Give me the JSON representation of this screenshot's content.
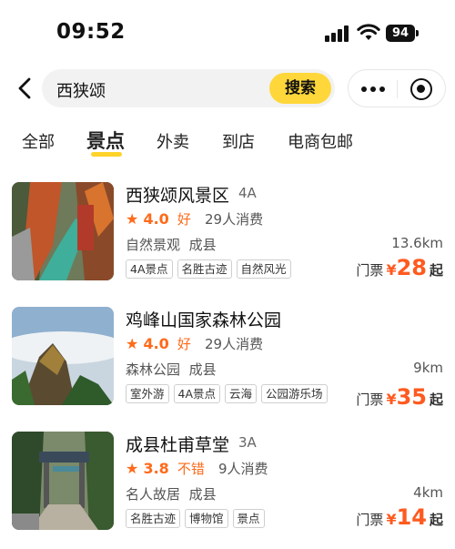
{
  "status_bar": {
    "time": "09:52",
    "battery": "94"
  },
  "search": {
    "query": "西狭颂",
    "button_label": "搜索"
  },
  "tabs": [
    {
      "label": "全部",
      "active": false
    },
    {
      "label": "景点",
      "active": true
    },
    {
      "label": "外卖",
      "active": false
    },
    {
      "label": "到店",
      "active": false
    },
    {
      "label": "电商包邮",
      "active": false
    }
  ],
  "results": [
    {
      "title": "西狭颂风景区",
      "level": "4A",
      "score": "4.0",
      "rating_word": "好",
      "consume": "29人消费",
      "category": "自然景观",
      "area": "成县",
      "distance": "13.6km",
      "tags": [
        "4A景点",
        "名胜古迹",
        "自然风光"
      ],
      "price_label": "门票",
      "currency": "¥",
      "price": "28",
      "price_suffix": "起"
    },
    {
      "title": "鸡峰山国家森林公园",
      "level": "",
      "score": "4.0",
      "rating_word": "好",
      "consume": "29人消费",
      "category": "森林公园",
      "area": "成县",
      "distance": "9km",
      "tags": [
        "室外游",
        "4A景点",
        "云海",
        "公园游乐场"
      ],
      "price_label": "门票",
      "currency": "¥",
      "price": "35",
      "price_suffix": "起"
    },
    {
      "title": "成县杜甫草堂",
      "level": "3A",
      "score": "3.8",
      "rating_word": "不错",
      "consume": "9人消费",
      "category": "名人故居",
      "area": "成县",
      "distance": "4km",
      "tags": [
        "名胜古迹",
        "博物馆",
        "景点"
      ],
      "price_label": "门票",
      "currency": "¥",
      "price": "14",
      "price_suffix": "起"
    }
  ],
  "colors": {
    "accent": "#ffd73a",
    "price": "#ff5a1f",
    "rating": "#ff6a1a"
  }
}
